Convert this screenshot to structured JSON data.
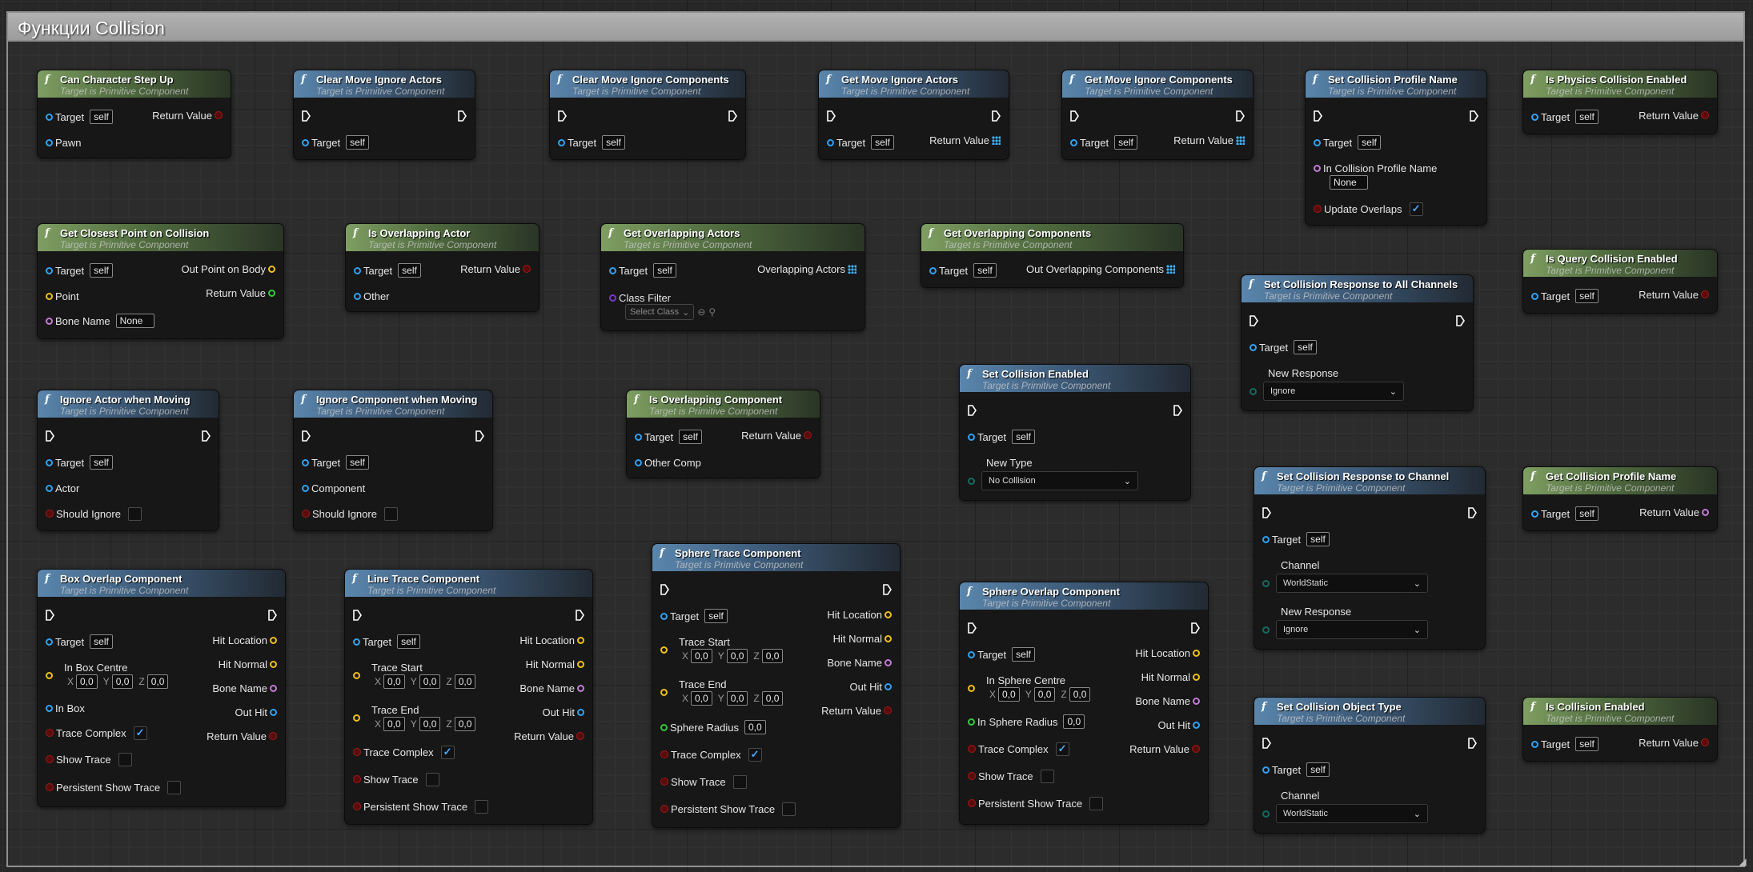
{
  "window": {
    "comment_title": "Функции Collision"
  },
  "common": {
    "subtitle": "Target is Primitive Component",
    "self": "self",
    "target": "Target",
    "return_value": "Return Value"
  },
  "nodes": {
    "can_step_up": {
      "title": "Can Character Step Up",
      "pawn": "Pawn"
    },
    "clear_actors": {
      "title": "Clear Move Ignore Actors"
    },
    "clear_comps": {
      "title": "Clear Move Ignore Components"
    },
    "get_actors": {
      "title": "Get Move Ignore Actors"
    },
    "get_comps": {
      "title": "Get Move Ignore Components"
    },
    "set_profile": {
      "title": "Set Collision Profile Name",
      "in_profile": "In Collision Profile Name",
      "none": "None",
      "update_overlaps": "Update Overlaps"
    },
    "is_physics": {
      "title": "Is Physics Collision Enabled"
    },
    "closest_point": {
      "title": "Get Closest Point on Collision",
      "point": "Point",
      "bone_name": "Bone Name",
      "none": "None",
      "out_point": "Out Point on Body"
    },
    "is_overlapping_actor": {
      "title": "Is Overlapping Actor",
      "other": "Other"
    },
    "get_overlapping_actors": {
      "title": "Get Overlapping Actors",
      "class_filter": "Class Filter",
      "select_class": "Select Class",
      "out": "Overlapping Actors"
    },
    "get_overlapping_comps": {
      "title": "Get Overlapping Components",
      "out": "Out Overlapping Components"
    },
    "resp_all": {
      "title": "Set Collision Response to All Channels",
      "new_response": "New Response",
      "value": "Ignore"
    },
    "is_query": {
      "title": "Is Query Collision Enabled"
    },
    "set_enabled": {
      "title": "Set Collision Enabled",
      "new_type": "New Type",
      "value": "No Collision"
    },
    "ignore_actor": {
      "title": "Ignore Actor when Moving",
      "actor": "Actor",
      "should_ignore": "Should Ignore"
    },
    "ignore_comp": {
      "title": "Ignore Component when Moving",
      "component": "Component",
      "should_ignore": "Should Ignore"
    },
    "is_overlapping_comp": {
      "title": "Is Overlapping Component",
      "other_comp": "Other Comp"
    },
    "resp_channel": {
      "title": "Set Collision Response to Channel",
      "channel": "Channel",
      "channel_value": "WorldStatic",
      "new_response": "New Response",
      "response_value": "Ignore"
    },
    "get_profile": {
      "title": "Get Collision Profile Name"
    },
    "box_overlap": {
      "title": "Box Overlap Component",
      "in_box_centre": "In Box Centre",
      "in_box": "In Box"
    },
    "line_trace": {
      "title": "Line Trace Component",
      "trace_start": "Trace Start",
      "trace_end": "Trace End"
    },
    "sphere_trace": {
      "title": "Sphere Trace Component",
      "trace_start": "Trace Start",
      "trace_end": "Trace End",
      "sphere_radius": "Sphere Radius"
    },
    "sphere_overlap": {
      "title": "Sphere Overlap Component",
      "in_sphere_centre": "In Sphere Centre",
      "in_sphere_radius": "In Sphere Radius"
    },
    "object_type": {
      "title": "Set Collision Object Type",
      "channel": "Channel",
      "value": "WorldStatic"
    },
    "is_enabled": {
      "title": "Is Collision Enabled"
    }
  },
  "trace": {
    "hit_location": "Hit Location",
    "hit_normal": "Hit Normal",
    "bone_name": "Bone Name",
    "out_hit": "Out Hit",
    "trace_complex": "Trace Complex",
    "show_trace": "Show Trace",
    "persistent_show_trace": "Persistent Show Trace",
    "x": "X",
    "y": "Y",
    "z": "Z",
    "zero": "0,0"
  }
}
